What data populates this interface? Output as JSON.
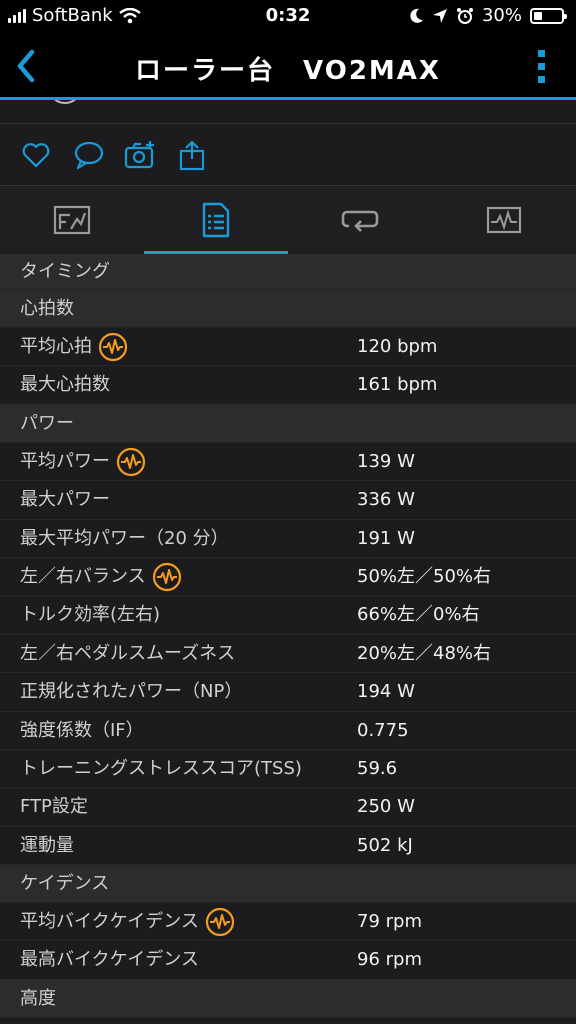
{
  "status_bar": {
    "carrier": "SoftBank",
    "time": "0:32",
    "battery": "30%",
    "battery_level": 0.3
  },
  "nav": {
    "title": "ローラー台　VO2MAX"
  },
  "actions": [
    "heart-icon",
    "comment-icon",
    "camera-add-icon",
    "share-icon"
  ],
  "tabs": [
    "summary-tab",
    "stats-tab",
    "laps-tab",
    "charts-tab"
  ],
  "active_tab": 1,
  "sections": {
    "timing": "タイミング",
    "heart_rate": "心拍数",
    "power": "パワー",
    "cadence": "ケイデンス",
    "altitude": "高度"
  },
  "heart_rate": [
    {
      "label": "平均心拍",
      "value": "120 bpm",
      "icon": true
    },
    {
      "label": "最大心拍数",
      "value": "161 bpm",
      "icon": false
    }
  ],
  "power": [
    {
      "label": "平均パワー",
      "value": "139 W",
      "icon": true
    },
    {
      "label": "最大パワー",
      "value": "336 W",
      "icon": false
    },
    {
      "label": "最大平均パワー（20 分）",
      "value": "191 W",
      "icon": false
    },
    {
      "label": "左／右バランス",
      "value": "50%左／50%右",
      "icon": true
    },
    {
      "label": "トルク効率(左右)",
      "value": "66%左／0%右",
      "icon": false
    },
    {
      "label": "左／右ペダルスムーズネス",
      "value": "20%左／48%右",
      "icon": false
    },
    {
      "label": "正規化されたパワー（NP）",
      "value": "194 W",
      "icon": false
    },
    {
      "label": "強度係数（IF）",
      "value": "0.775",
      "icon": false
    },
    {
      "label": "トレーニングストレススコア(TSS)",
      "value": "59.6",
      "icon": false
    },
    {
      "label": "FTP設定",
      "value": "250 W",
      "icon": false
    },
    {
      "label": "運動量",
      "value": "502 kJ",
      "icon": false
    }
  ],
  "cadence": [
    {
      "label": "平均バイクケイデンス",
      "value": "79 rpm",
      "icon": true
    },
    {
      "label": "最高バイクケイデンス",
      "value": "96 rpm",
      "icon": false
    }
  ],
  "colors": {
    "accent": "#1a9bd8",
    "pulse_icon": "#f39c1e"
  }
}
